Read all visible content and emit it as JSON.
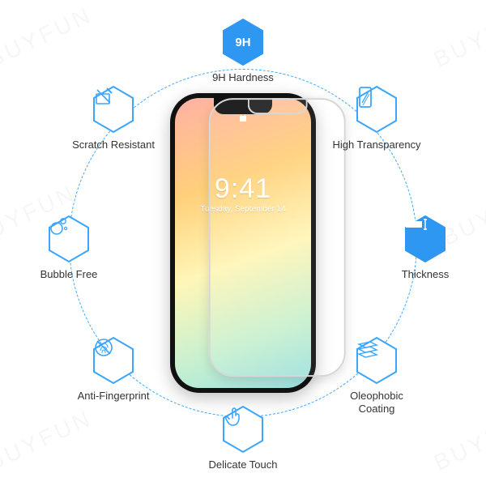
{
  "watermark": "BUYFUN",
  "phone": {
    "time": "9:41",
    "date": "Tuesday, September 14"
  },
  "features": {
    "hardness": {
      "label": "9H Hardness",
      "badge": "9H"
    },
    "scratch": {
      "label": "Scratch Resistant"
    },
    "transparency": {
      "label": "High Transparency"
    },
    "bubble": {
      "label": "Bubble Free"
    },
    "thickness": {
      "label": "Thickness"
    },
    "fingerprint": {
      "label": "Anti-Fingerprint"
    },
    "oleophobic": {
      "label": "Oleophobic Coating"
    },
    "touch": {
      "label": "Delicate Touch"
    }
  }
}
